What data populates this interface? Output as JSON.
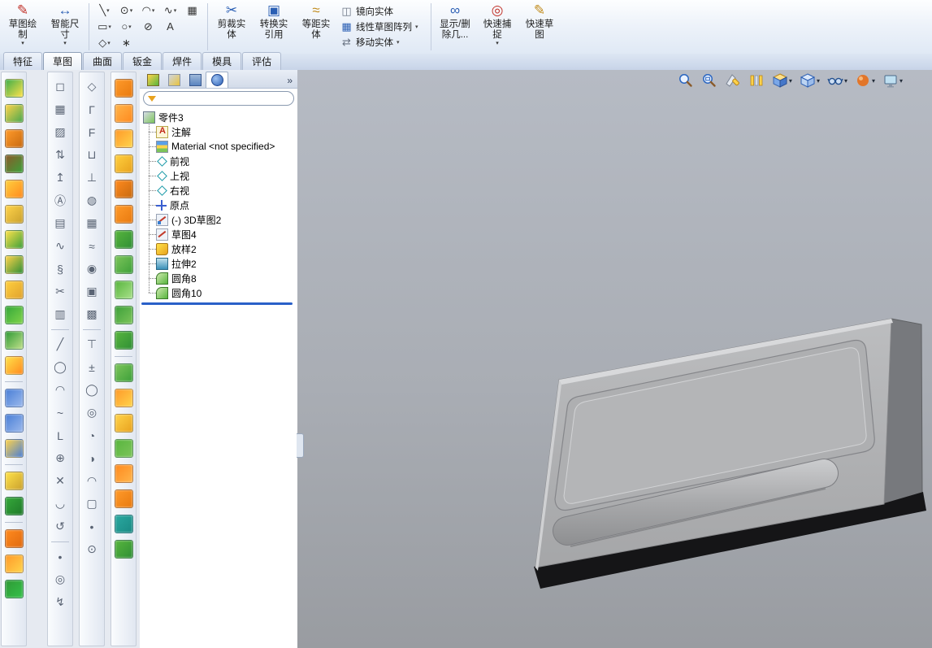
{
  "ui": {
    "caret": "▾",
    "chevron": "»"
  },
  "colors": {
    "accent_blue": "#2b5fb4",
    "rollback_blue": "#2a60c8",
    "viewport_top": "#b6bbc4",
    "viewport_bottom": "#999ca1",
    "part_gray": "#b2b3b5"
  },
  "ribbon": {
    "sketch_draw": {
      "glyph": "✎",
      "line1": "草图绘",
      "line2": "制"
    },
    "smart_dimension": {
      "glyph": "↔",
      "line1": "智能尺",
      "line2": "寸"
    },
    "trim": {
      "glyph": "✂",
      "line1": "剪裁实",
      "line2": "体"
    },
    "convert": {
      "glyph": "▣",
      "line1": "转换实",
      "line2": "引用"
    },
    "offset": {
      "glyph": "≈",
      "line1": "等距实",
      "line2": "体"
    },
    "mirror": {
      "glyph": "◫",
      "label": "镜向实体"
    },
    "linear_pattern": {
      "glyph": "▦",
      "label": "线性草图阵列"
    },
    "move": {
      "glyph": "⇄",
      "label": "移动实体"
    },
    "display_delete": {
      "glyph": "∞",
      "line1": "显示/删",
      "line2": "除几..."
    },
    "quick_snap": {
      "glyph": "◎",
      "line1": "快速捕",
      "line2": "捉"
    },
    "rapid_sketch": {
      "glyph": "✎",
      "line1": "快速草",
      "line2": "图"
    },
    "sketch_grid": [
      [
        {
          "n": "line-icon",
          "g": "╲",
          "caret": true
        },
        {
          "n": "circle-icon",
          "g": "⊙",
          "caret": true
        },
        {
          "n": "arc-icon",
          "g": "◠",
          "caret": true
        },
        {
          "n": "spline-icon",
          "g": "∿",
          "caret": true
        },
        {
          "n": "sketch-pattern-icon",
          "g": "▦",
          "caret": false
        }
      ],
      [
        {
          "n": "rectangle-icon",
          "g": "▭",
          "caret": true
        },
        {
          "n": "ellipse-icon",
          "g": "○",
          "caret": true
        },
        {
          "n": "conic-icon",
          "g": "⊘",
          "caret": false
        },
        {
          "n": "text-icon",
          "g": "A",
          "caret": false
        }
      ],
      [
        {
          "n": "polygon-icon",
          "g": "◇",
          "caret": true
        },
        {
          "n": "point-icon",
          "g": "∗",
          "caret": false
        }
      ]
    ]
  },
  "tabs": [
    {
      "label": "特征",
      "active": false
    },
    {
      "label": "草图",
      "active": true
    },
    {
      "label": "曲面",
      "active": false
    },
    {
      "label": "钣金",
      "active": false
    },
    {
      "label": "焊件",
      "active": false
    },
    {
      "label": "模具",
      "active": false
    },
    {
      "label": "评估",
      "active": false
    }
  ],
  "feature_tree": {
    "items": [
      {
        "label": "零件3",
        "type": "part",
        "root": true
      },
      {
        "label": "注解",
        "type": "annotations"
      },
      {
        "label": "Material <not specified>",
        "type": "material"
      },
      {
        "label": "前视",
        "type": "plane"
      },
      {
        "label": "上视",
        "type": "plane"
      },
      {
        "label": "右视",
        "type": "plane"
      },
      {
        "label": "原点",
        "type": "origin"
      },
      {
        "label": "(-) 3D草图2",
        "type": "sketch3d"
      },
      {
        "label": "草图4",
        "type": "sketch"
      },
      {
        "label": "放样2",
        "type": "loft"
      },
      {
        "label": "拉伸2",
        "type": "extrude"
      },
      {
        "label": "圆角8",
        "type": "fillet"
      },
      {
        "label": "圆角10",
        "type": "fillet"
      }
    ]
  },
  "view_toolbar": {
    "icons": [
      {
        "n": "zoom-to-fit-icon",
        "caret": false
      },
      {
        "n": "zoom-to-area-icon",
        "caret": false
      },
      {
        "n": "section-view-icon",
        "caret": false
      },
      {
        "n": "view-settings-icon",
        "caret": false
      },
      {
        "n": "display-style-icon",
        "caret": true
      },
      {
        "n": "view-orientation-icon",
        "caret": true
      },
      {
        "n": "hide-show-items-icon",
        "caret": true
      },
      {
        "n": "edit-appearance-icon",
        "caret": true
      },
      {
        "n": "apply-scene-icon",
        "caret": true
      }
    ]
  },
  "left_toolbars": {
    "columns": [
      {
        "name": "features-toolbar",
        "items": [
          [
            "#3fae49",
            "#ffe24a"
          ],
          [
            "#ffd34a",
            "#4aa84e"
          ],
          [
            "#ff9a2a",
            "#c86a10"
          ],
          [
            "#8a5a2a",
            "#3da03a"
          ],
          [
            "#ffcf3e",
            "#ff8a1e"
          ],
          [
            "#ffd34a",
            "#caa12e"
          ],
          [
            "#ffe24a",
            "#3da03a"
          ],
          [
            "#ffd34a",
            "#2f8f35"
          ],
          [
            "#ffcf3e",
            "#e0a22e"
          ],
          [
            "#35a83a",
            "#7fd34a"
          ],
          [
            "#2f9a35",
            "#bfe08a"
          ],
          [
            "#ffe24a",
            "#ff8a1e"
          ],
          "|",
          [
            "#4a7fd6",
            "#9ab8ec"
          ],
          [
            "#4a7fd6",
            "#9ab8ec"
          ],
          [
            "#ffd34a",
            "#4a7fd6"
          ],
          "|",
          [
            "#ffe24a",
            "#caa12e"
          ],
          [
            "#35a83a",
            "#1f7a2a"
          ],
          "|",
          [
            "#ff8a1e",
            "#e06a10"
          ],
          [
            "#ff9a2a",
            "#ffd34a"
          ],
          [
            "#2f9a35",
            "#35c04a"
          ]
        ]
      },
      {
        "name": "sketch-tools-toolbar",
        "items": [
          "◻",
          "▦",
          "▨",
          "⇅",
          "↥",
          "Ⓐ",
          "▤",
          "∿",
          "§",
          "✂",
          "▥",
          "|",
          "╱",
          "◯",
          "◠",
          "~",
          "L",
          "⊕",
          "✕",
          "◡",
          "↺",
          "|",
          "•",
          "◎",
          "↯"
        ]
      },
      {
        "name": "standard-tools-toolbar",
        "items": [
          "◇",
          "Γ",
          "F",
          "⊔",
          "⊥",
          "◍",
          "▦",
          "≈",
          "◉",
          "▣",
          "▩",
          "|",
          "⊤",
          "±",
          "◯",
          "◎",
          "◔",
          "◑",
          "◠",
          "▢",
          "•",
          "⊙"
        ]
      },
      {
        "name": "surfaces-toolbar",
        "items": [
          [
            "#ff9a2a",
            "#e87a10"
          ],
          [
            "#ffb44a",
            "#ff8a1e"
          ],
          [
            "#ff9a2a",
            "#ffd34a"
          ],
          [
            "#ffcf3e",
            "#e8a21e"
          ],
          [
            "#ff8a1e",
            "#c86a10"
          ],
          [
            "#ff9a2a",
            "#e87a10"
          ],
          [
            "#58b53e",
            "#2f8f35"
          ],
          [
            "#7cc45a",
            "#3da03a"
          ],
          [
            "#58b53e",
            "#a8e08a"
          ],
          [
            "#3da03a",
            "#7cc45a"
          ],
          [
            "#58b53e",
            "#2f8f35"
          ],
          "|",
          [
            "#7cc45a",
            "#3da03a"
          ],
          [
            "#ff9a2a",
            "#ffd34a"
          ],
          [
            "#ffd34a",
            "#e8a21e"
          ],
          [
            "#58b53e",
            "#7cc45a"
          ],
          [
            "#ff8a1e",
            "#ffb44a"
          ],
          [
            "#ff9a2a",
            "#e87a10"
          ],
          [
            "#2aa8a0",
            "#1a8a84"
          ],
          [
            "#58b53e",
            "#2f8f35"
          ]
        ]
      }
    ]
  }
}
